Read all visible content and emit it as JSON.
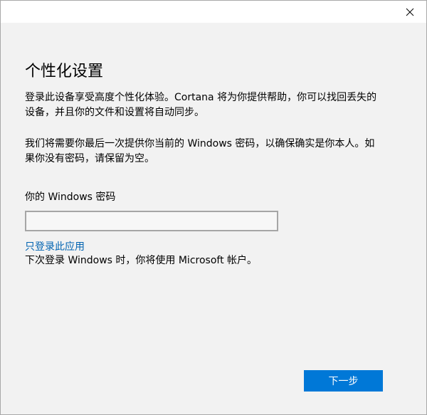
{
  "window": {
    "close_icon": "close-icon"
  },
  "main": {
    "title": "个性化设置",
    "paragraph1": "登录此设备享受高度个性化体验。Cortana 将为你提供帮助，你可以找回丢失的设备，并且你的文件和设置将自动同步。",
    "paragraph2": "我们将需要你最后一次提供你当前的 Windows 密码，以确保确实是你本人。如果你没有密码，请保留为空。",
    "password_label": "你的 Windows 密码",
    "password_value": "",
    "local_only_link": "只登录此应用",
    "local_only_hint": "下次登录 Windows 时，你将使用 Microsoft 帐户。",
    "next_button": "下一步"
  },
  "colors": {
    "accent": "#0078d7",
    "link": "#0063b1",
    "background": "#f2f2f2",
    "titlebar": "#ffffff"
  }
}
